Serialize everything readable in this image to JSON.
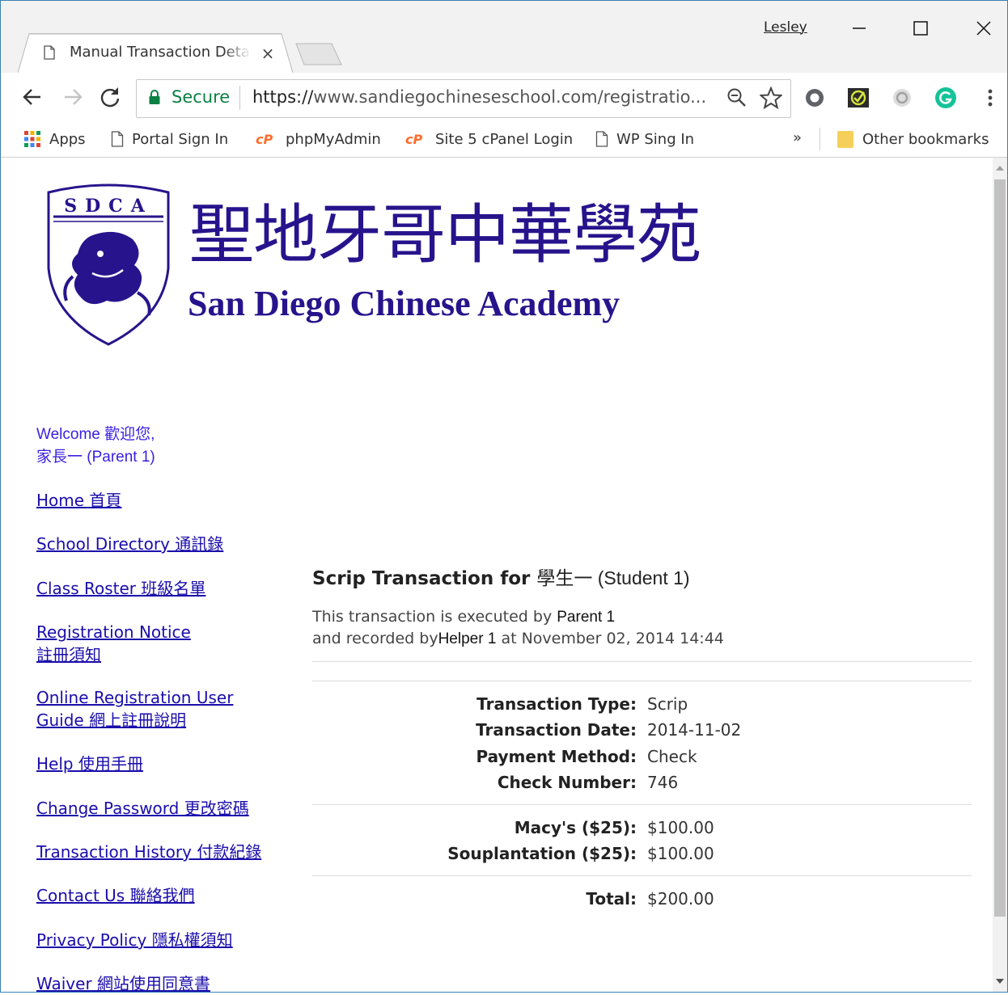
{
  "browser": {
    "tab_title": "Manual Transaction Deta",
    "tab_close": "×",
    "profile_name": "Lesley",
    "secure_label": "Secure",
    "url_scheme": "https://",
    "url_rest": "www.sandiegochineseschool.com/registratio...",
    "bookmarks": {
      "apps": "Apps",
      "portal": "Portal Sign In",
      "phpmyadmin": "phpMyAdmin",
      "cpanel": "Site 5 cPanel Login",
      "wp": "WP Sing In",
      "more": "»",
      "other": "Other bookmarks"
    }
  },
  "logo": {
    "crest_text": "SDCA",
    "chinese": "聖地牙哥中華學苑",
    "english": "San Diego Chinese Academy"
  },
  "sidebar": {
    "welcome_line1": "Welcome 歡迎您,",
    "welcome_line2": "家長一 (Parent 1)",
    "links": [
      {
        "label": "Home 首頁"
      },
      {
        "label": "School Directory 通訊錄"
      },
      {
        "label": "Class Roster 班級名單"
      },
      {
        "label": "Registration Notice",
        "label2": "註冊須知"
      },
      {
        "label": "Online Registration User",
        "label2": "Guide 網上註冊說明"
      },
      {
        "label": "Help 使用手冊"
      },
      {
        "label": "Change Password 更改密碼"
      },
      {
        "label": "Transaction History 付款紀錄"
      },
      {
        "label": "Contact Us 聯絡我們"
      },
      {
        "label": "Privacy Policy 隱私權須知"
      },
      {
        "label": "Waiver 網站使用同意書"
      }
    ]
  },
  "transaction": {
    "heading_prefix": "Scrip Transaction for",
    "student": "學生一 (Student 1)",
    "exec_prefix": "This transaction is executed by",
    "executed_by": "Parent 1",
    "recorded_prefix": "and recorded by",
    "recorded_by": "Helper 1",
    "recorded_at": "at November 02, 2014 14:44",
    "details": [
      {
        "label": "Transaction Type:",
        "value": "Scrip"
      },
      {
        "label": "Transaction Date:",
        "value": "2014-11-02"
      },
      {
        "label": "Payment Method:",
        "value": "Check"
      },
      {
        "label": "Check Number:",
        "value": "746"
      }
    ],
    "items": [
      {
        "label": "Macy's ($25):",
        "value": "$100.00"
      },
      {
        "label": "Souplantation ($25):",
        "value": "$100.00"
      }
    ],
    "total_label": "Total:",
    "total_value": "$200.00"
  },
  "colors": {
    "brand": "#27148c",
    "link": "#1a0dab",
    "secure": "#0b8043"
  }
}
